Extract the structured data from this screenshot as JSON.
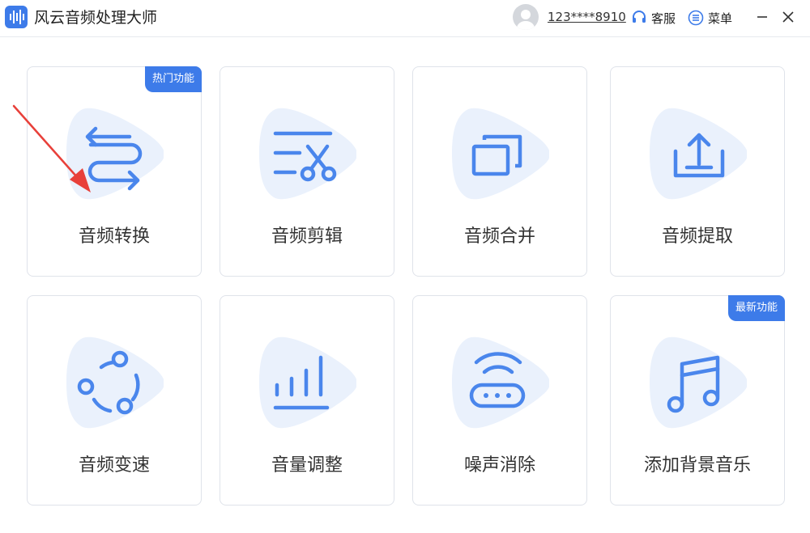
{
  "app": {
    "title": "风云音频处理大师"
  },
  "header": {
    "user": "123****8910",
    "service_label": "客服",
    "menu_label": "菜单"
  },
  "features": [
    {
      "label": "音频转换",
      "badge": "热门功能",
      "icon": "convert-arrows-icon"
    },
    {
      "label": "音频剪辑",
      "icon": "scissors-icon"
    },
    {
      "label": "音频合并",
      "icon": "merge-windows-icon"
    },
    {
      "label": "音频提取",
      "icon": "upload-tray-icon"
    },
    {
      "label": "音频变速",
      "icon": "orbit-dots-icon"
    },
    {
      "label": "音量调整",
      "icon": "volume-bars-icon"
    },
    {
      "label": "噪声消除",
      "icon": "router-signal-icon"
    },
    {
      "label": "添加背景音乐",
      "badge": "最新功能",
      "icon": "music-note-icon"
    }
  ],
  "colors": {
    "accent": "#3d7be9",
    "icon_bg": "#eaf1fc",
    "annotation_arrow": "#e8403a"
  }
}
